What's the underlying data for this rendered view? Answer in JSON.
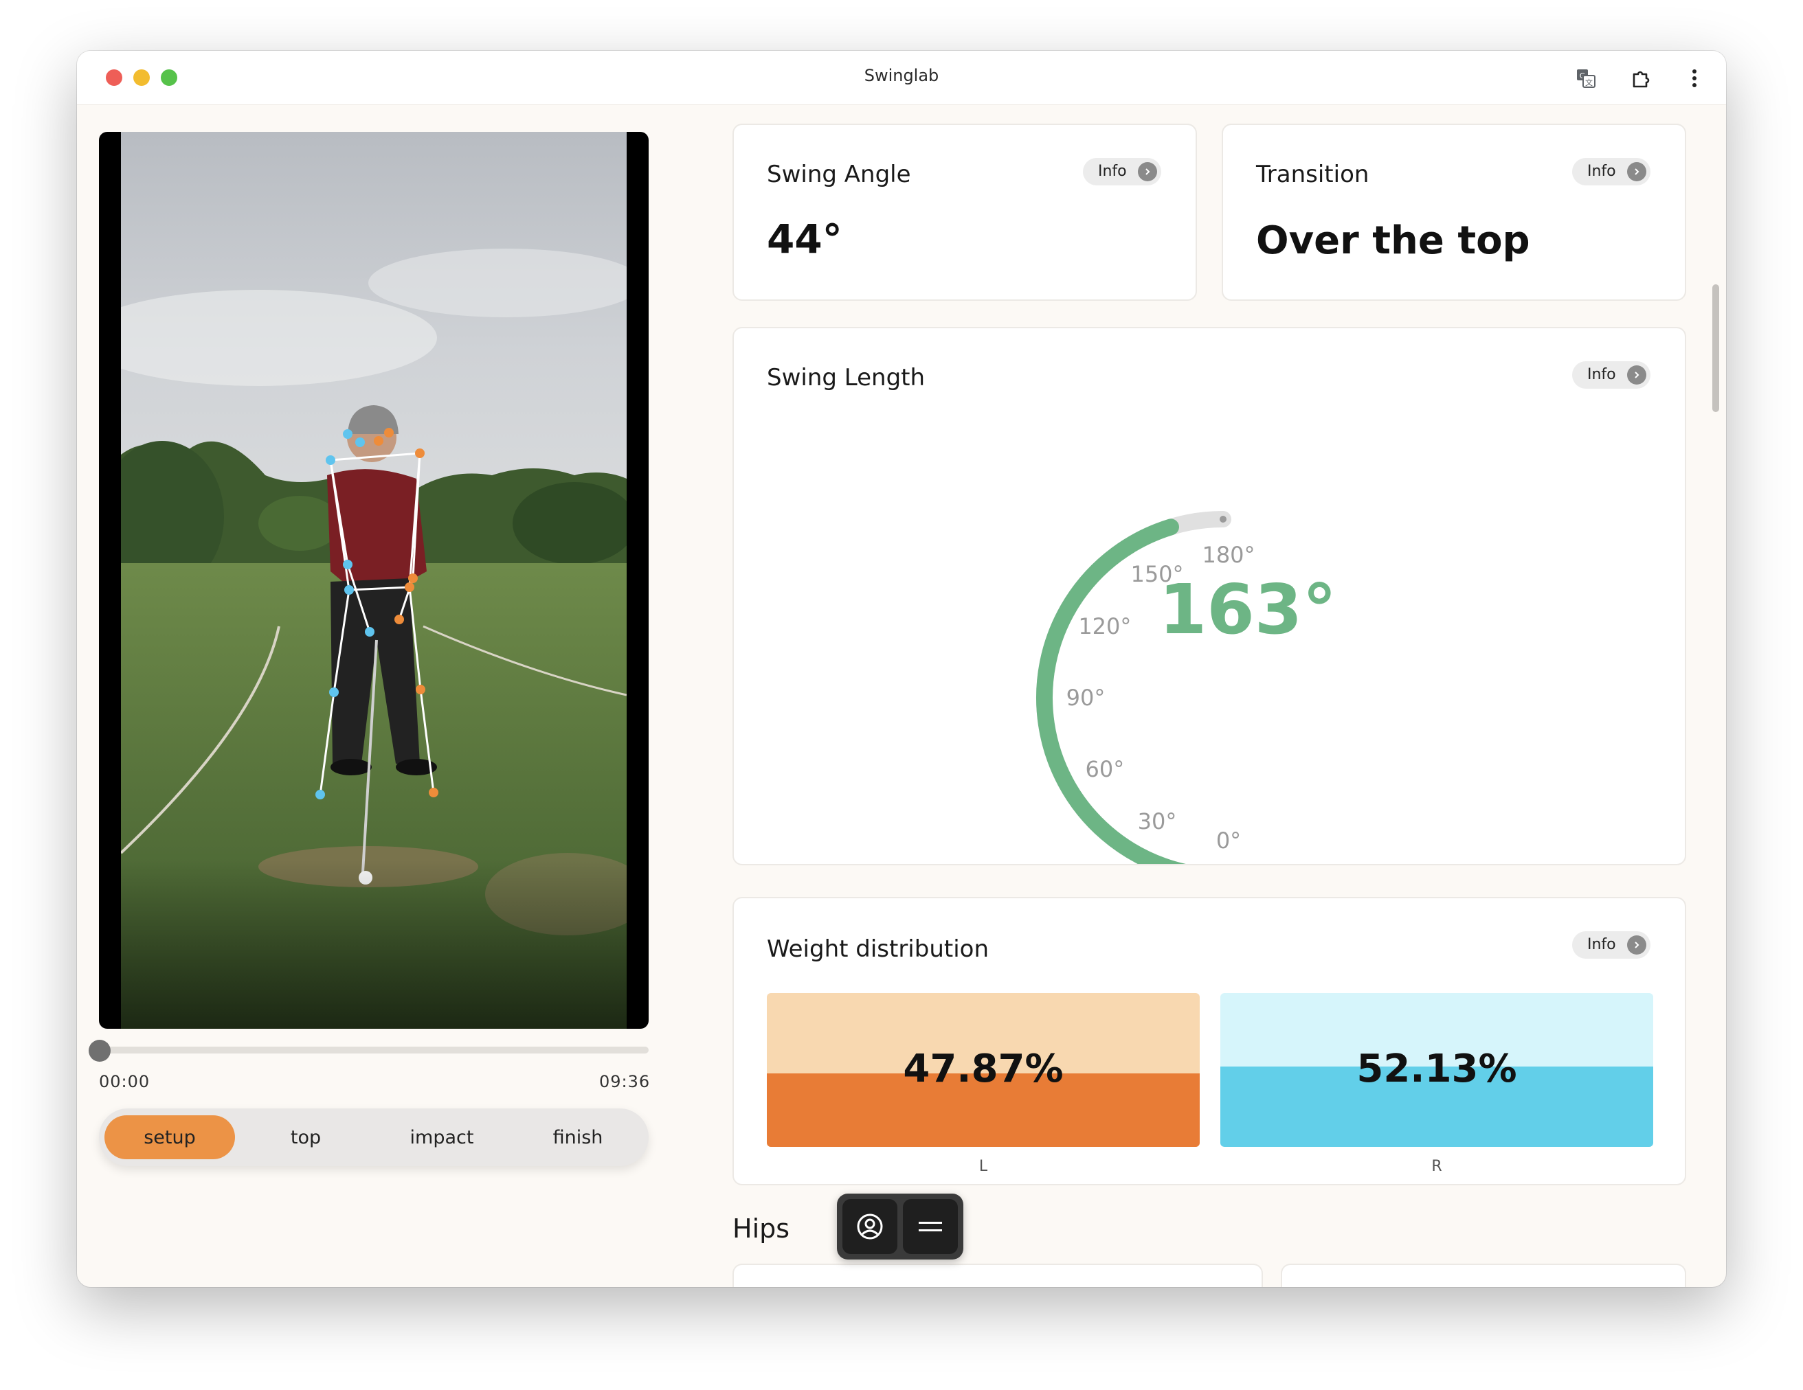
{
  "window": {
    "title": "Swinglab"
  },
  "toolbar_icons": [
    "translate-icon",
    "extension-icon",
    "more-vert-icon"
  ],
  "video": {
    "current_time": "00:00",
    "duration": "09:36",
    "progress": 0.0,
    "controls": [
      "skip-back-icon",
      "play-icon",
      "skip-forward-icon"
    ]
  },
  "phases": {
    "items": [
      "setup",
      "top",
      "impact",
      "finish"
    ],
    "selected": "setup"
  },
  "swing_angle": {
    "title": "Swing Angle",
    "value": "44°",
    "info_label": "Info"
  },
  "transition": {
    "title": "Transition",
    "value": "Over the top",
    "info_label": "Info"
  },
  "swing_length": {
    "title": "Swing Length",
    "info_label": "Info",
    "value_text": "163°",
    "value_deg": 163,
    "max_deg": 180,
    "ticks": [
      "0°",
      "30°",
      "60°",
      "90°",
      "120°",
      "150°",
      "180°"
    ],
    "color": "#6db585",
    "track_color": "#e0e0e0"
  },
  "weight": {
    "title": "Weight distribution",
    "info_label": "Info",
    "left": {
      "value": "47.87%",
      "label": "L",
      "fraction": 0.4787,
      "light": "#f8d8b0",
      "dark": "#e87c36"
    },
    "right": {
      "value": "52.13%",
      "label": "R",
      "fraction": 0.5213,
      "light": "#d6f5fb",
      "dark": "#62cfe9"
    }
  },
  "hips": {
    "title": "Hips"
  },
  "dock": [
    "person-circle-icon",
    "menu-icon"
  ]
}
